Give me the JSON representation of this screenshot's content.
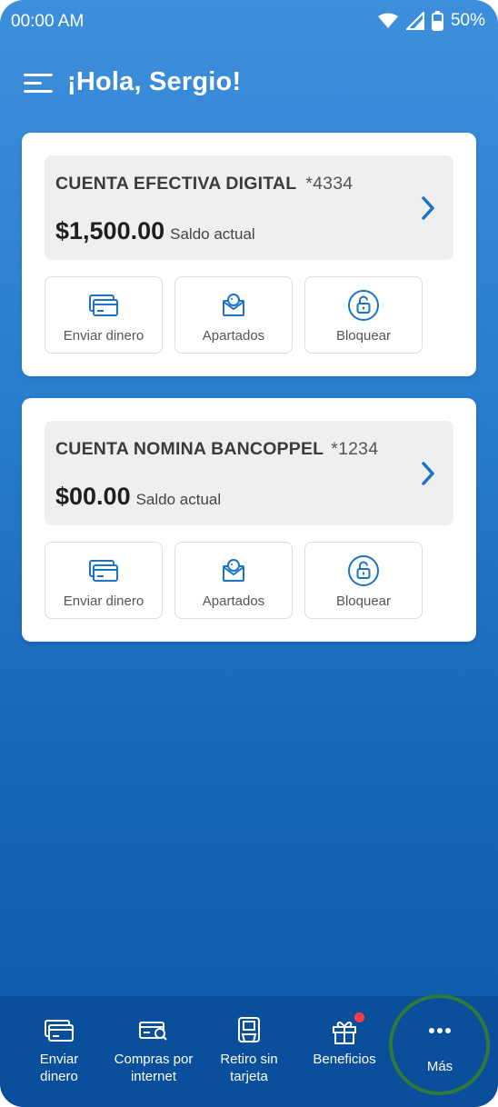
{
  "status_bar": {
    "time": "00:00 AM",
    "battery": "50%"
  },
  "header": {
    "greeting": "¡Hola, Sergio!"
  },
  "accounts": [
    {
      "name": "CUENTA EFECTIVA DIGITAL",
      "number": "*4334",
      "balance": "$1,500.00",
      "balance_label": "Saldo actual",
      "actions": [
        {
          "label": "Enviar dinero",
          "icon": "card-send-icon"
        },
        {
          "label": "Apartados",
          "icon": "piggy-envelope-icon"
        },
        {
          "label": "Bloquear",
          "icon": "lock-icon"
        }
      ]
    },
    {
      "name": "CUENTA NOMINA BANCOPPEL",
      "number": "*1234",
      "balance": "$00.00",
      "balance_label": "Saldo actual",
      "actions": [
        {
          "label": "Enviar dinero",
          "icon": "card-send-icon"
        },
        {
          "label": "Apartados",
          "icon": "piggy-envelope-icon"
        },
        {
          "label": "Bloquear",
          "icon": "lock-icon"
        }
      ]
    }
  ],
  "bottom_nav": [
    {
      "label": "Enviar dinero",
      "icon": "cards-icon"
    },
    {
      "label": "Compras por internet",
      "icon": "card-search-icon"
    },
    {
      "label": "Retiro sin tarjeta",
      "icon": "atm-icon"
    },
    {
      "label": "Beneficios",
      "icon": "gift-icon"
    },
    {
      "label": "Más",
      "icon": "more-dots-icon"
    }
  ],
  "colors": {
    "background_top": "#3d8fdb",
    "background_bottom": "#0e5aa8",
    "bottom_nav": "#0a4f9c",
    "accent_icon": "#1a73c8",
    "notification_dot": "#ff3b4a",
    "highlight_ring": "#2f7a3a"
  }
}
